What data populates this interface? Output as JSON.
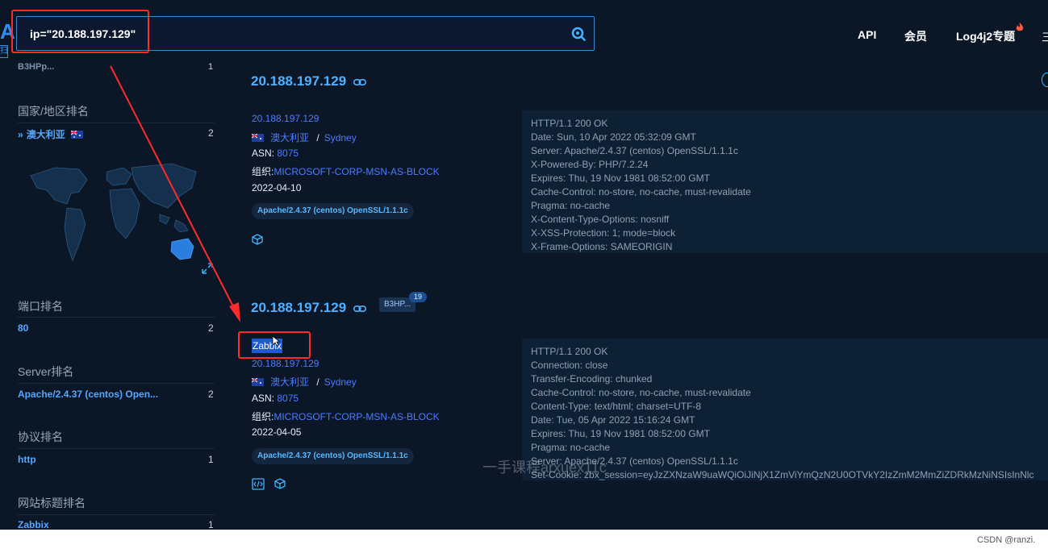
{
  "header": {
    "logo": "A",
    "logo_sub": "扫",
    "search": "ip=\"20.188.197.129\"",
    "nav": [
      "API",
      "会员",
      "Log4j2专题"
    ],
    "menu": "三"
  },
  "sidebar": {
    "top_item": "B3HPp...",
    "top_count": "1",
    "country_title": "国家/地区排名",
    "country_item": "澳大利亚",
    "country_count": "2",
    "port_title": "端口排名",
    "port_item": "80",
    "port_count": "2",
    "server_title": "Server排名",
    "server_item": "Apache/2.4.37 (centos) Open...",
    "server_count": "2",
    "protocol_title": "协议排名",
    "protocol_item": "http",
    "protocol_count": "1",
    "webtitle_title": "网站标题排名",
    "webtitle_item": "Zabbix",
    "webtitle_count": "1"
  },
  "results": [
    {
      "ip_title": "20.188.197.129",
      "ip": "20.188.197.129",
      "country": "澳大利亚",
      "sep": "/",
      "city": "Sydney",
      "asn_label": "ASN:",
      "asn": "8075",
      "org_label": "组织:",
      "org": "MICROSOFT-CORP-MSN-AS-BLOCK",
      "date": "2022-04-10",
      "server_tag": "Apache/2.4.37 (centos) OpenSSL/1.1.1c",
      "headers": [
        "HTTP/1.1 200 OK",
        "Date: Sun, 10 Apr 2022 05:32:09 GMT",
        "Server: Apache/2.4.37 (centos) OpenSSL/1.1.1c",
        "X-Powered-By: PHP/7.2.24",
        "Expires: Thu, 19 Nov 1981 08:52:00 GMT",
        "Cache-Control: no-store, no-cache, must-revalidate",
        "Pragma: no-cache",
        "X-Content-Type-Options: nosniff",
        "X-XSS-Protection: 1; mode=block",
        "X-Frame-Options: SAMEORIGIN"
      ]
    },
    {
      "ip_title": "20.188.197.129",
      "badge": "B3HP...",
      "badge_count": "19",
      "site_title": "Zabbix",
      "ip": "20.188.197.129",
      "country": "澳大利亚",
      "sep": "/",
      "city": "Sydney",
      "asn_label": "ASN:",
      "asn": "8075",
      "org_label": "组织:",
      "org": "MICROSOFT-CORP-MSN-AS-BLOCK",
      "date": "2022-04-05",
      "server_tag": "Apache/2.4.37 (centos) OpenSSL/1.1.1c",
      "headers": [
        "HTTP/1.1 200 OK",
        "Connection: close",
        "Transfer-Encoding: chunked",
        "Cache-Control: no-store, no-cache, must-revalidate",
        "Content-Type: text/html; charset=UTF-8",
        "Date: Tue, 05 Apr 2022 15:16:24 GMT",
        "Expires: Thu, 19 Nov 1981 08:52:00 GMT",
        "Pragma: no-cache",
        "Server: Apache/2.4.37 (centos) OpenSSL/1.1.1c",
        "Set-Cookie: zbx_session=eyJzZXNzaW9uaWQiOiJiNjX1ZmViYmQzN2U0OTVkY2IzZmM2MmZiZDRkMzNiNSIsInNlc"
      ]
    }
  ],
  "watermark": "一手课程arxuex11c",
  "footer": "CSDN @ranzi.",
  "colors": {
    "accent": "#4fb1ff",
    "link": "#4a7dff",
    "annotation": "#ff2a2a",
    "background": "#0b1627"
  }
}
